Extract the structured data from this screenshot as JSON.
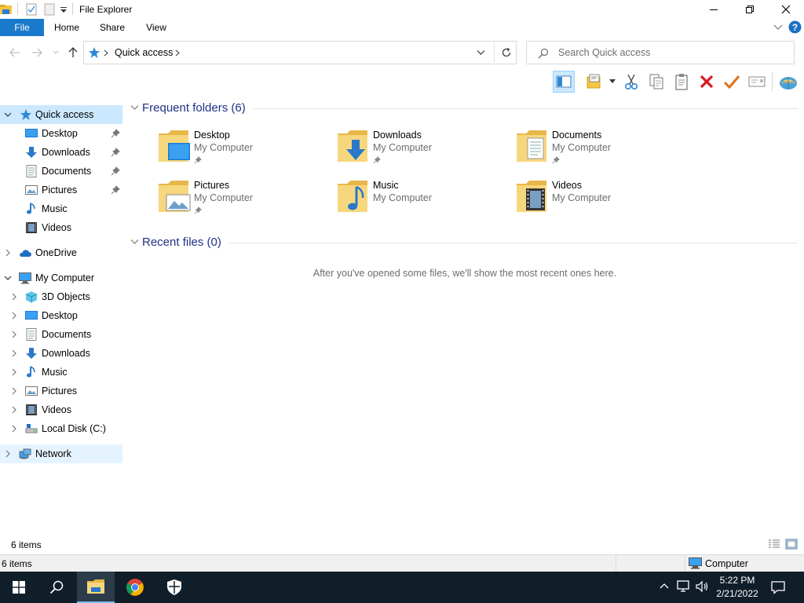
{
  "window": {
    "title": "File Explorer"
  },
  "ribbon": {
    "tabs": [
      "File",
      "Home",
      "Share",
      "View"
    ]
  },
  "address": {
    "crumb": "Quick access"
  },
  "search": {
    "placeholder": "Search Quick access"
  },
  "nav": {
    "quick_access": "Quick access",
    "quick_items": [
      "Desktop",
      "Downloads",
      "Documents",
      "Pictures",
      "Music",
      "Videos"
    ],
    "onedrive": "OneDrive",
    "my_computer": "My Computer",
    "computer_items": [
      "3D Objects",
      "Desktop",
      "Documents",
      "Downloads",
      "Music",
      "Pictures",
      "Videos",
      "Local Disk (C:)"
    ],
    "network": "Network"
  },
  "content": {
    "frequent_header": "Frequent folders (6)",
    "recent_header": "Recent files (0)",
    "empty_message": "After you've opened some files, we'll show the most recent ones here.",
    "folders": [
      {
        "name": "Desktop",
        "location": "My Computer",
        "pinned": true,
        "icon": "desktop-folder-icon"
      },
      {
        "name": "Downloads",
        "location": "My Computer",
        "pinned": true,
        "icon": "downloads-folder-icon"
      },
      {
        "name": "Documents",
        "location": "My Computer",
        "pinned": true,
        "icon": "documents-folder-icon"
      },
      {
        "name": "Pictures",
        "location": "My Computer",
        "pinned": true,
        "icon": "pictures-folder-icon"
      },
      {
        "name": "Music",
        "location": "My Computer",
        "pinned": false,
        "icon": "music-folder-icon"
      },
      {
        "name": "Videos",
        "location": "My Computer",
        "pinned": false,
        "icon": "videos-folder-icon"
      }
    ]
  },
  "status": {
    "items_count": "6 items",
    "bottom_count": "6 items",
    "computer_label": "Computer"
  },
  "taskbar": {
    "time": "5:22 PM",
    "date": "2/21/2022"
  },
  "colors": {
    "file_tab": "#1979ca",
    "selection": "#cce8ff",
    "group_header": "#1e3287",
    "taskbar": "#101e2a"
  }
}
